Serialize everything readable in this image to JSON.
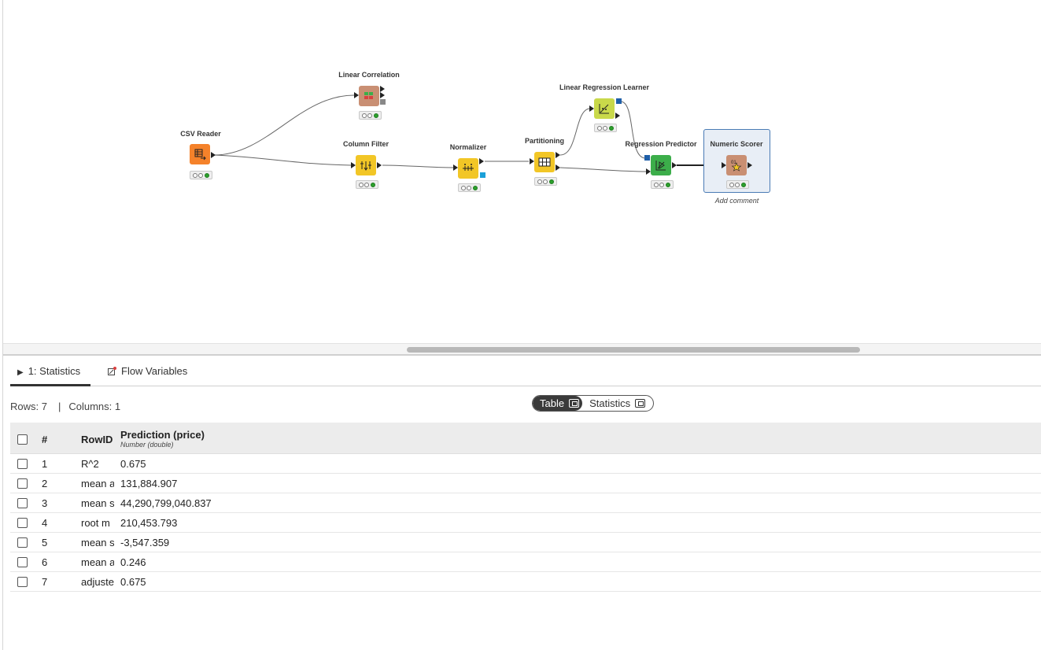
{
  "workflow": {
    "nodes": [
      {
        "key": "csv",
        "label": "CSV Reader",
        "color": "#f5822a"
      },
      {
        "key": "corr",
        "label": "Linear Correlation",
        "color": "#c98f73"
      },
      {
        "key": "filter",
        "label": "Column Filter",
        "color": "#f2c626"
      },
      {
        "key": "norm",
        "label": "Normalizer",
        "color": "#f2c626"
      },
      {
        "key": "part",
        "label": "Partitioning",
        "color": "#f2c626"
      },
      {
        "key": "learner",
        "label": "Linear Regression Learner",
        "color": "#c9d94a"
      },
      {
        "key": "predictor",
        "label": "Regression Predictor",
        "color": "#3cae4a"
      },
      {
        "key": "scorer",
        "label": "Numeric Scorer",
        "color": "#c98f73"
      }
    ],
    "add_comment": "Add comment"
  },
  "panel": {
    "tabs": [
      {
        "label": "1: Statistics"
      },
      {
        "label": "Flow Variables"
      }
    ],
    "rows_label": "Rows: 7",
    "cols_label": "Columns: 1",
    "sep": "|",
    "toggle": {
      "table": "Table",
      "statistics": "Statistics"
    }
  },
  "table": {
    "headers": {
      "num": "#",
      "rowid": "RowID",
      "col": "Prediction (price)",
      "col_type": "Number (double)"
    },
    "rows": [
      {
        "num": "1",
        "id": "R^2",
        "val": "0.675"
      },
      {
        "num": "2",
        "id": "mean a",
        "val": "131,884.907"
      },
      {
        "num": "3",
        "id": "mean s",
        "val": "44,290,799,040.837"
      },
      {
        "num": "4",
        "id": "root m",
        "val": "210,453.793"
      },
      {
        "num": "5",
        "id": "mean s",
        "val": "-3,547.359"
      },
      {
        "num": "6",
        "id": "mean a",
        "val": "0.246"
      },
      {
        "num": "7",
        "id": "adjuste",
        "val": "0.675"
      }
    ]
  }
}
